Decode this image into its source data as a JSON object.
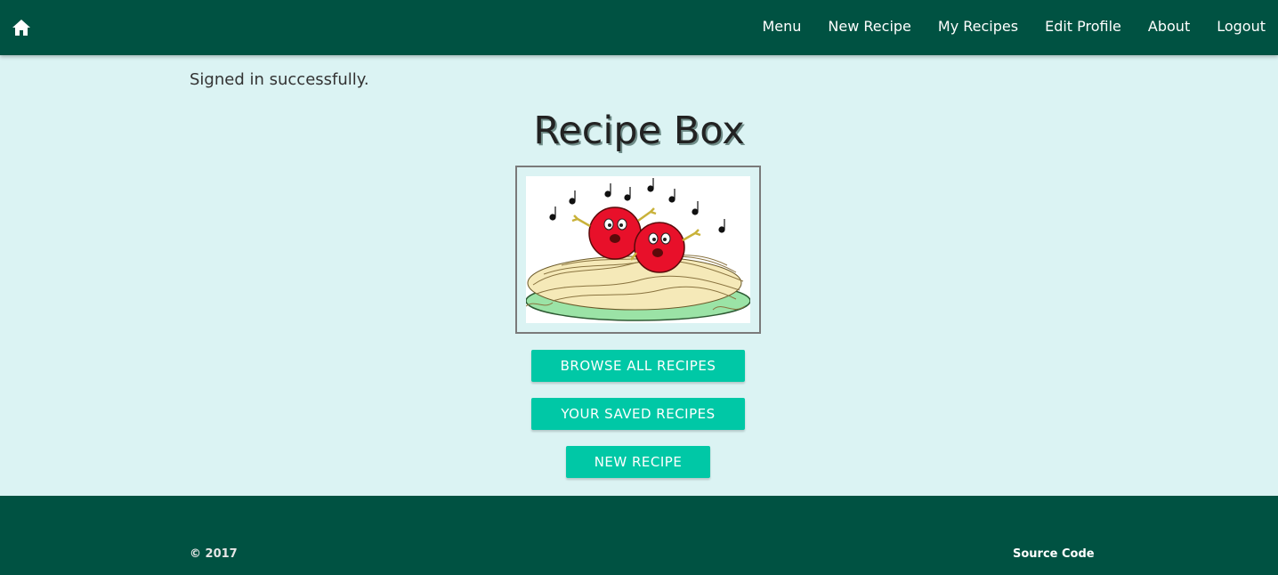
{
  "nav": {
    "home_icon": "home-icon",
    "links": [
      "Menu",
      "New Recipe",
      "My Recipes",
      "Edit Profile",
      "About",
      "Logout"
    ]
  },
  "flash": "Signed in successfully.",
  "title": "Recipe Box",
  "buttons": {
    "browse": "BROWSE ALL RECIPES",
    "saved": "YOUR SAVED RECIPES",
    "new_recipe": "NEW RECIPE"
  },
  "footer": {
    "copyright": "© 2017",
    "source": "Source Code"
  },
  "colors": {
    "nav_bg": "#005242",
    "page_bg": "#dbf3f3",
    "button": "#00c8a6"
  }
}
